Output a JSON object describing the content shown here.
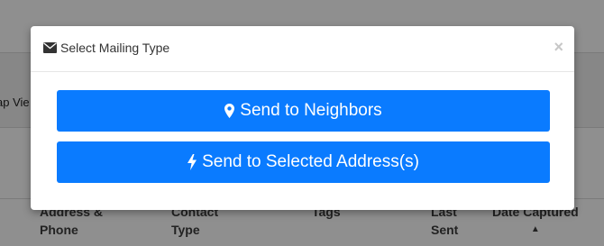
{
  "background": {
    "map_view_label": "ap Vie",
    "table_headers": [
      {
        "line1": "Address &",
        "line2": "Phone"
      },
      {
        "line1": "Contact",
        "line2": "Type"
      },
      {
        "line1": "",
        "line2": "Tags"
      },
      {
        "line1": "Last",
        "line2": "Sent"
      },
      {
        "line1": "Date Captured",
        "line2": "▲"
      }
    ]
  },
  "modal": {
    "title": "Select Mailing Type",
    "title_icon": "envelope-icon",
    "close_label": "×",
    "buttons": [
      {
        "label": "Send to Neighbors",
        "icon": "map-marker-icon"
      },
      {
        "label": "Send to Selected Address(s)",
        "icon": "bolt-icon"
      }
    ]
  },
  "colors": {
    "overlay": "#8f8f8f",
    "button": "#0a7bff",
    "button_text": "#ffffff"
  }
}
